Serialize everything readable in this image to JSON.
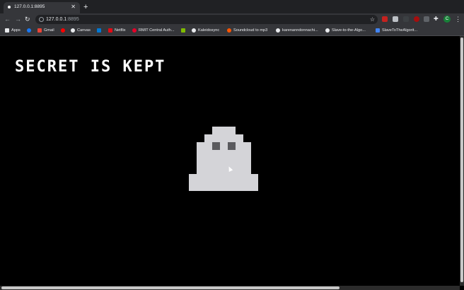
{
  "browser": {
    "tab": {
      "title": "127.0.0.1:8895"
    },
    "url": {
      "host": "127.0.0.1",
      "port": ":8895"
    },
    "profile_initial": "C",
    "bookmarks": [
      {
        "label": "Apps",
        "icon": "apps-grid-icon",
        "color": "#e8eaed"
      },
      {
        "label": "",
        "icon": "facebook-icon",
        "color": "#1877f2"
      },
      {
        "label": "Gmail",
        "icon": "gmail-icon",
        "color": "#ea4335"
      },
      {
        "label": "",
        "icon": "youtube-icon",
        "color": "#ff0000"
      },
      {
        "label": "Canvas",
        "icon": "globe-icon",
        "color": "#e8eaed"
      },
      {
        "label": "",
        "icon": "vscode-icon",
        "color": "#0078d4"
      },
      {
        "label": "Netflix",
        "icon": "netflix-icon",
        "color": "#e50914"
      },
      {
        "label": "RMIT Central Auth...",
        "icon": "rmit-icon",
        "color": "#e60028"
      },
      {
        "label": "",
        "icon": "microsoft-icon",
        "color": "#7fba00"
      },
      {
        "label": "Kaleidosync",
        "icon": "globe-icon",
        "color": "#e8eaed"
      },
      {
        "label": "Soundcloud to mp3",
        "icon": "soundcloud-icon",
        "color": "#ff5500"
      },
      {
        "label": "karenanndonnachi...",
        "icon": "github-icon",
        "color": "#e8eaed"
      },
      {
        "label": "Slave-to-the-Algo...",
        "icon": "github-icon",
        "color": "#e8eaed"
      },
      {
        "label": "SlaveToTheAlgorit...",
        "icon": "triangle-icon",
        "color": "#4285f4"
      }
    ]
  },
  "page": {
    "headline": "SECRET IS KEPT"
  },
  "colors": {
    "background": "#000000",
    "ghost": "#d4d4d8",
    "ghost_eyes": "#5a5a5e"
  }
}
